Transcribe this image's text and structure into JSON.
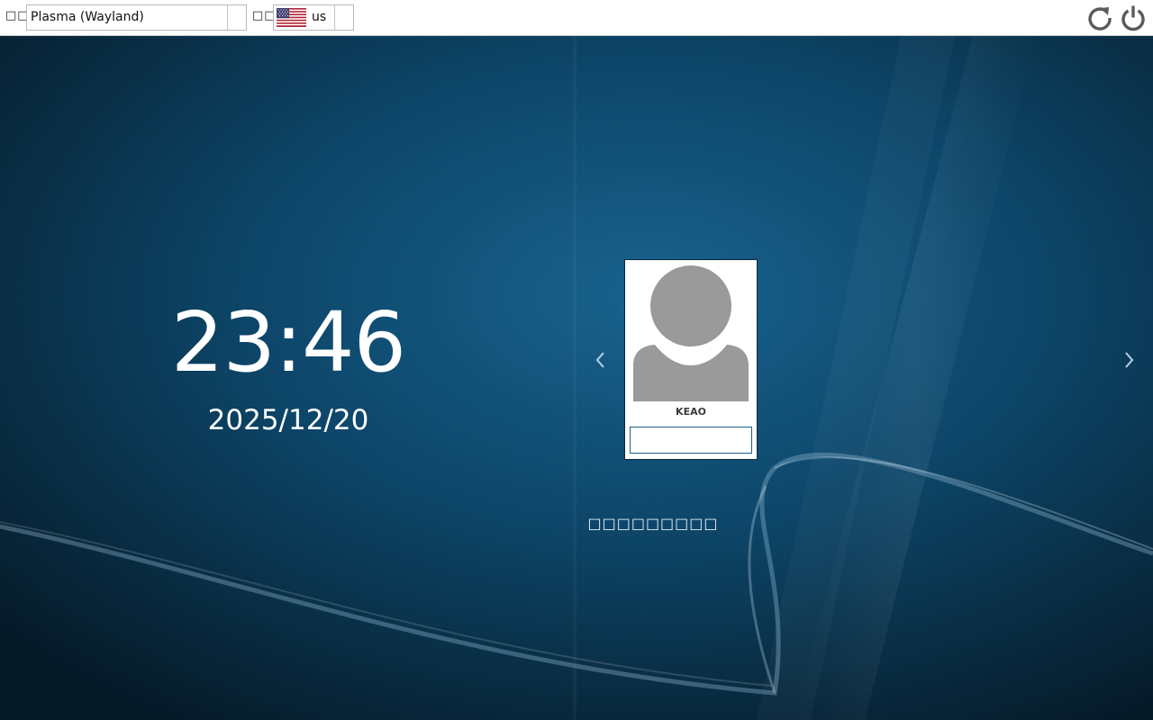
{
  "topbar": {
    "session_label": "□□",
    "session_value": "Plasma (Wayland)",
    "layout_label": "□□",
    "layout_value": "us"
  },
  "icons": {
    "flag": "us-flag-icon",
    "reboot": "reboot-icon",
    "shutdown": "power-icon",
    "prev": "chevron-left-icon",
    "next": "chevron-right-icon"
  },
  "clock": {
    "time": "23:46",
    "date": "2025/12/20"
  },
  "user": {
    "name": "KEAO",
    "password_value": ""
  },
  "status": {
    "message": "□□□□□□□□□"
  },
  "colors": {
    "accent": "#1f5f88",
    "background": "#0b3550",
    "avatar": "#9a9a9a"
  }
}
